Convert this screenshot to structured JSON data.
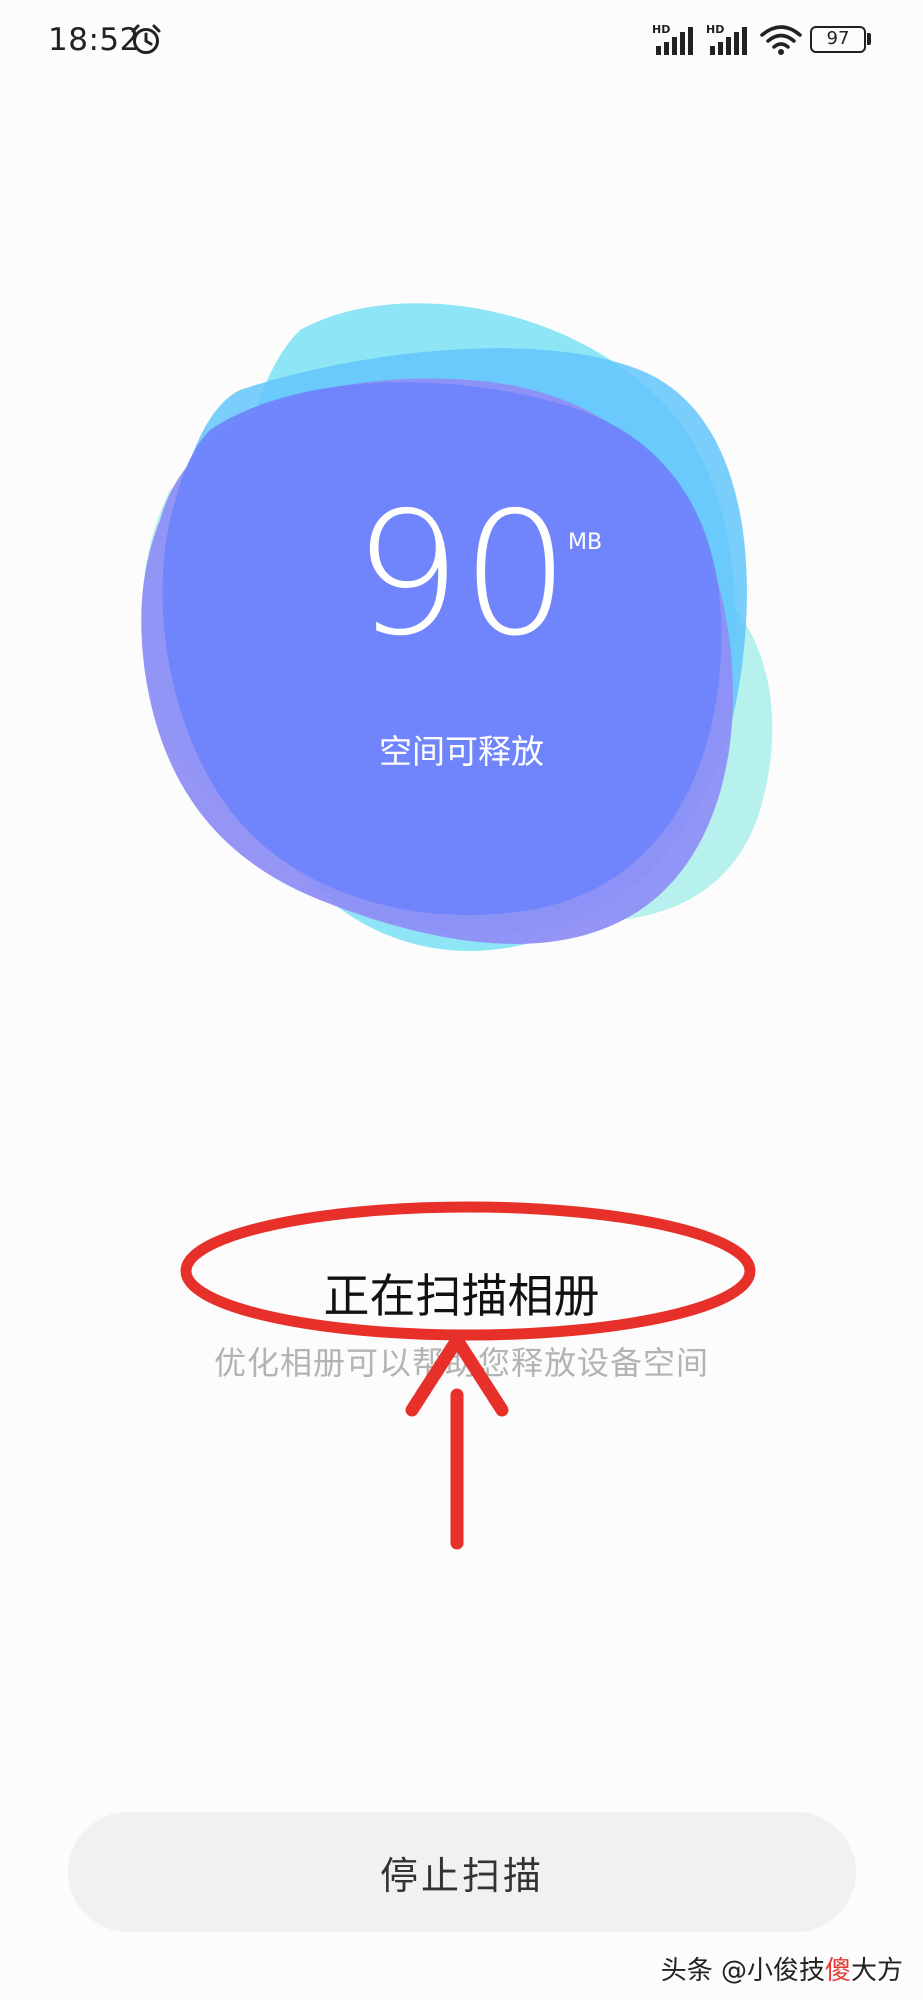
{
  "status_bar": {
    "time": "18:52",
    "network_1": "HD",
    "network_2": "HD",
    "battery_level": "97",
    "icons": [
      "alarm-icon",
      "signal-icon",
      "signal-icon",
      "wifi-icon",
      "battery-icon"
    ]
  },
  "cleanup": {
    "space_value": "90",
    "space_unit": "MB",
    "space_label": "空间可释放",
    "blob_colors": [
      "#aef0ec",
      "#79e0f5",
      "#63c6fb",
      "#8f8ff6",
      "#6f84fb"
    ]
  },
  "scan": {
    "title": "正在扫描相册",
    "subtitle": "优化相册可以帮助您释放设备空间"
  },
  "annotation": {
    "color": "#e8302a"
  },
  "actions": {
    "stop_label": "停止扫描"
  },
  "watermark": {
    "prefix": "头条 @小俊技",
    "highlight": "傻",
    "suffix": "大方"
  }
}
